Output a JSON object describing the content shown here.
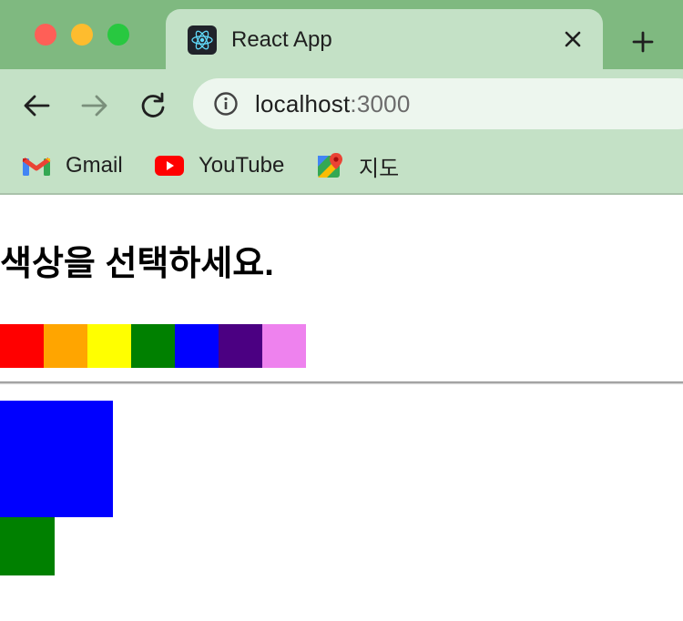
{
  "browser": {
    "tab": {
      "title": "React App",
      "favicon": "react-icon"
    },
    "address": {
      "host": "localhost",
      "port": ":3000"
    },
    "bookmarks": [
      {
        "label": "Gmail",
        "icon": "gmail-icon"
      },
      {
        "label": "YouTube",
        "icon": "youtube-icon"
      },
      {
        "label": "지도",
        "icon": "maps-icon"
      }
    ],
    "colors": {
      "tabbar": "#7fb980",
      "toolbar": "#c4e1c6",
      "omnibox": "#edf6ee"
    }
  },
  "page": {
    "heading": "색상을 선택하세요.",
    "swatches": [
      {
        "name": "red",
        "color": "#ff0000"
      },
      {
        "name": "orange",
        "color": "#ffa500"
      },
      {
        "name": "yellow",
        "color": "#ffff00"
      },
      {
        "name": "green",
        "color": "#008000"
      },
      {
        "name": "blue",
        "color": "#0000ff"
      },
      {
        "name": "indigo",
        "color": "#4b0082"
      },
      {
        "name": "violet",
        "color": "#ee82ee"
      }
    ],
    "selected_color": "#0000ff",
    "secondary_color": "#008000"
  }
}
